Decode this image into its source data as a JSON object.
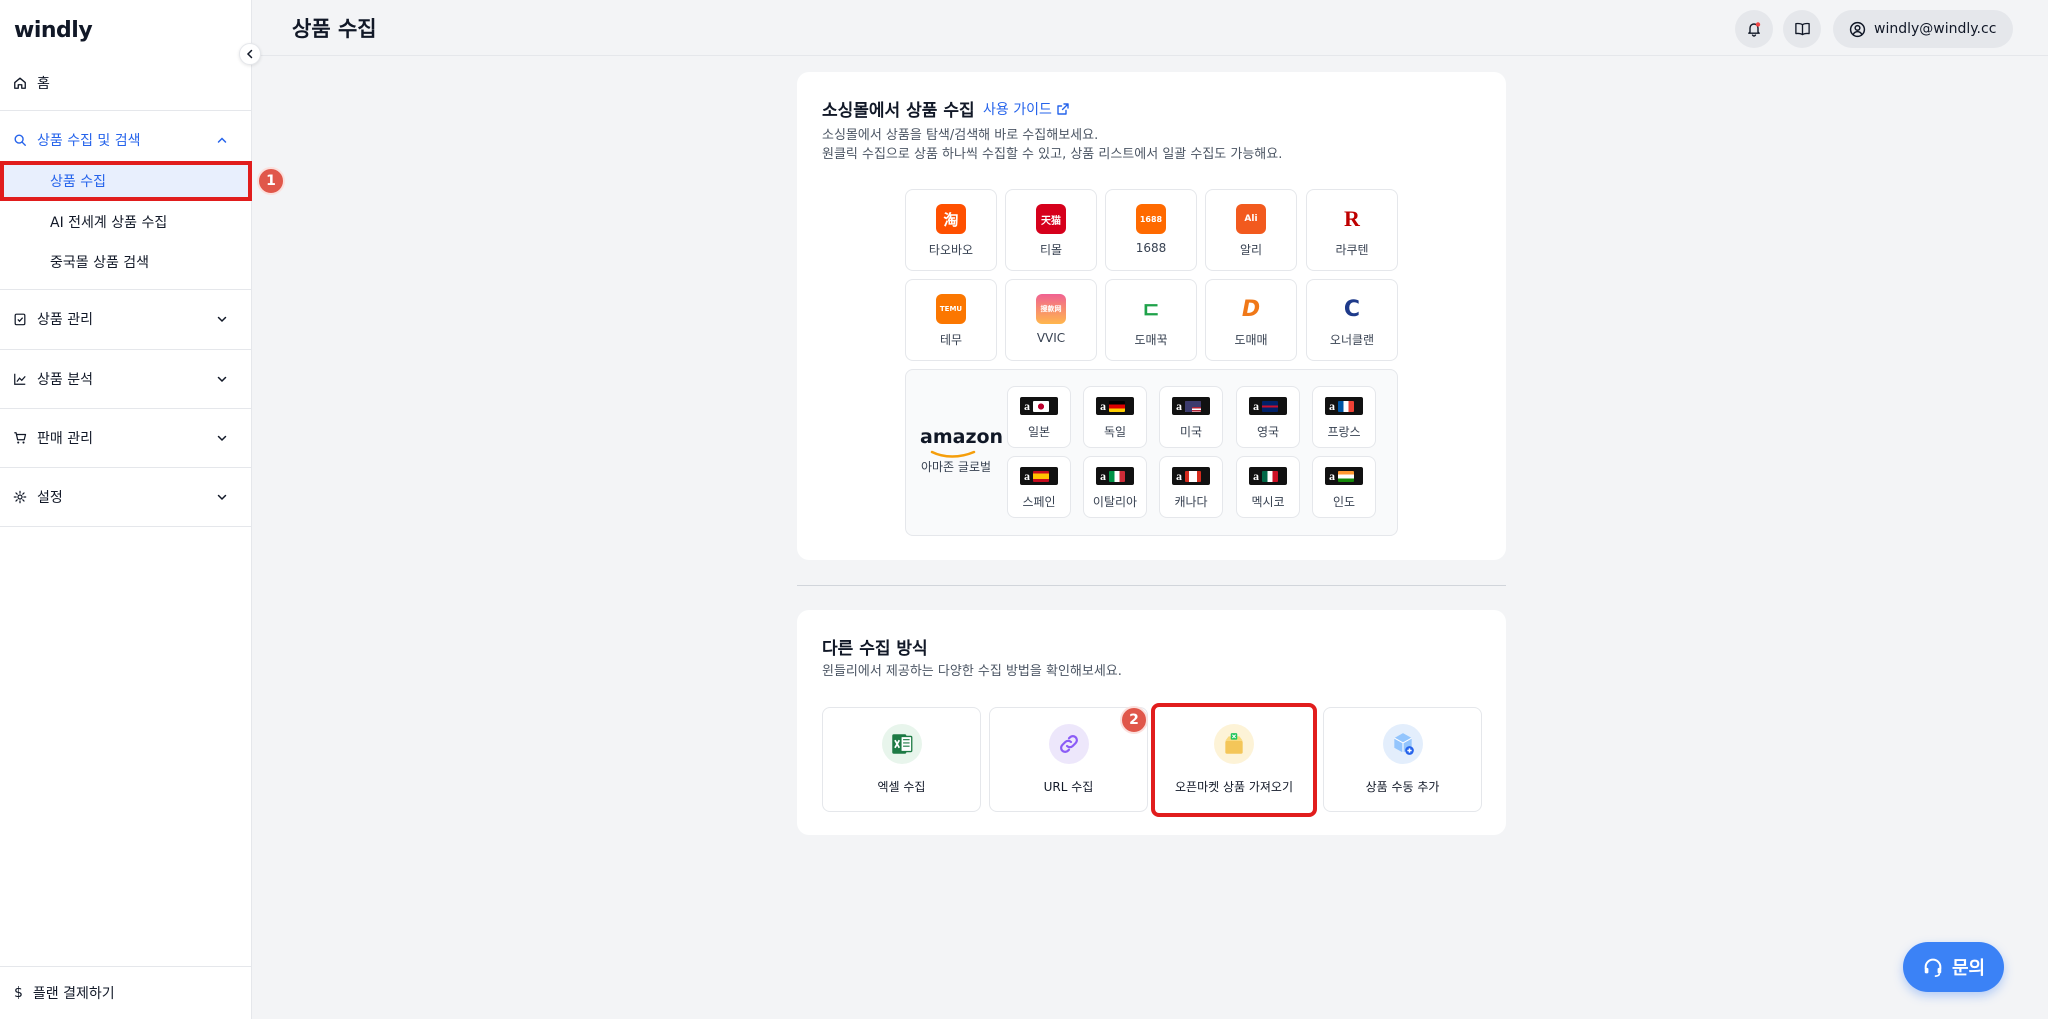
{
  "app": {
    "logo": "windly"
  },
  "header": {
    "title": "상품 수집",
    "user_email": "windly@windly.cc"
  },
  "sidebar": {
    "home": "홈",
    "groups": [
      {
        "label": "상품 수집 및 검색",
        "expanded": true,
        "items": [
          "상품 수집",
          "AI 전세계 상품 수집",
          "중국몰 상품 검색"
        ]
      },
      {
        "label": "상품 관리"
      },
      {
        "label": "상품 분석"
      },
      {
        "label": "판매 관리"
      },
      {
        "label": "설정"
      }
    ],
    "footer": "플랜 결제하기"
  },
  "annotations": [
    "1",
    "2"
  ],
  "social": {
    "title": "소싱몰에서 상품 수집",
    "guide_link": "사용 가이드",
    "desc1": "소싱몰에서 상품을 탐색/검색해 바로 수집해보세요.",
    "desc2": "원클릭 수집으로 상품 하나씩 수집할 수 있고, 상품 리스트에서 일괄 수집도 가능해요.",
    "shops": [
      {
        "name": "타오바오",
        "glyph": "淘",
        "color": "#ff5000"
      },
      {
        "name": "티몰",
        "glyph": "天猫",
        "color": "#d6001c"
      },
      {
        "name": "1688",
        "glyph": "1688",
        "color": "#ff6a00"
      },
      {
        "name": "알리",
        "glyph": "Ali",
        "color": "#f25a1e"
      },
      {
        "name": "라쿠텐",
        "glyph": "R",
        "color": "#ffffff"
      },
      {
        "name": "테무",
        "glyph": "TEMU",
        "color": "#fb7701"
      },
      {
        "name": "VVIC",
        "glyph": "搜款网",
        "color": "#f06292"
      },
      {
        "name": "도매꾹",
        "glyph": "ㄷ",
        "color": "#ffffff"
      },
      {
        "name": "도매매",
        "glyph": "D",
        "color": "#ffffff"
      },
      {
        "name": "오너클랜",
        "glyph": "C",
        "color": "#ffffff"
      }
    ],
    "amazon": {
      "logo": "amazon",
      "label": "아마존 글로벌",
      "countries": [
        "일본",
        "독일",
        "미국",
        "영국",
        "프랑스",
        "스페인",
        "이탈리아",
        "캐나다",
        "멕시코",
        "인도"
      ]
    }
  },
  "other": {
    "title": "다른 수집 방식",
    "desc": "윈들리에서 제공하는 다양한 수집 방법을 확인해보세요.",
    "methods": [
      "엑셀 수집",
      "URL 수집",
      "오픈마켓 상품 가져오기",
      "상품 수동 추가"
    ]
  },
  "help_button": "문의",
  "colors": {
    "accent": "#2563eb",
    "highlight": "#e11d1d",
    "badge": "#e0574a"
  }
}
